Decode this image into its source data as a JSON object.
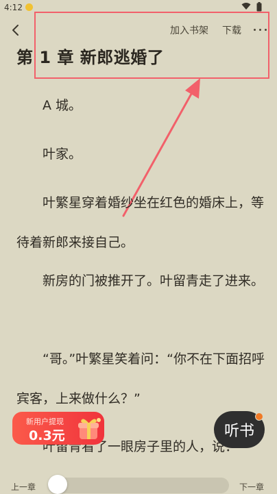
{
  "status_bar": {
    "time": "4:12",
    "icons": [
      "notification-icon",
      "wifi-icon",
      "battery-icon"
    ]
  },
  "toolbar": {
    "back_icon": "chevron-left-icon",
    "add_to_shelf": "加入书架",
    "download": "下载",
    "more_icon": "more-icon"
  },
  "chapter": {
    "title": "第 1 章 新郎逃婚了",
    "paragraphs": [
      "A 城。",
      "叶家。",
      "叶繁星穿着婚纱坐在红色的婚床上，等待着新郎来接自己。",
      "新房的门被推开了。叶留青走了进来。",
      "“哥。”叶繁星笑着问：“你不在下面招呼宾客，上来做什么？”",
      "叶留青看了一眼房子里的人，说："
    ]
  },
  "promo": {
    "label": "新用户提现",
    "amount": "0.3元",
    "icon": "gift-icon"
  },
  "listen": {
    "label": "听书"
  },
  "footer": {
    "prev": "上一章",
    "next": "下一章",
    "progress": 0
  },
  "colors": {
    "background": "#dcd8c3",
    "annotation": "#f2606a",
    "promo": "#f0343c",
    "listen_button": "#2f2f2f",
    "listen_dot": "#f07a26"
  }
}
